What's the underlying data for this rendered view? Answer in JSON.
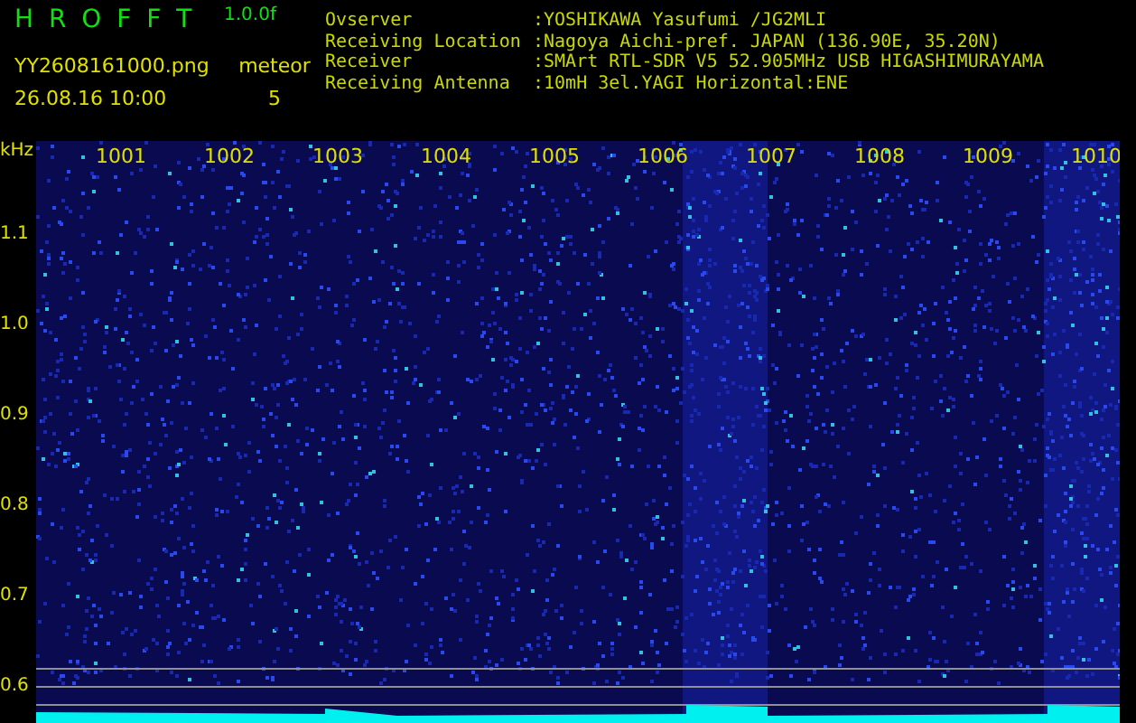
{
  "app": {
    "title": "H R O F F T",
    "version": "1.0.0f"
  },
  "file": {
    "name": "YY2608161000.png",
    "datetime": "26.08.16 10:00"
  },
  "meteor": {
    "label": "meteor",
    "count": "5"
  },
  "info": [
    {
      "label": "Ovserver",
      "value": ":YOSHIKAWA Yasufumi /JG2MLI"
    },
    {
      "label": "Receiving Location",
      "value": ":Nagoya Aichi-pref. JAPAN (136.90E, 35.20N)"
    },
    {
      "label": "Receiver",
      "value": ":SMArt RTL-SDR V5 52.905MHz USB HIGASHIMURAYAMA"
    },
    {
      "label": "Receiving Antenna",
      "value": ":10mH 3el.YAGI Horizontal:ENE"
    }
  ],
  "spectrogram": {
    "unit": "kHz",
    "y_labels": [
      "1.1",
      "1.0",
      "0.9",
      "0.8",
      "0.7",
      "0.6"
    ],
    "time_labels": [
      "1001",
      "1002",
      "1003",
      "1004",
      "1005",
      "1006",
      "1007",
      "1008",
      "1009",
      "1010"
    ]
  }
}
